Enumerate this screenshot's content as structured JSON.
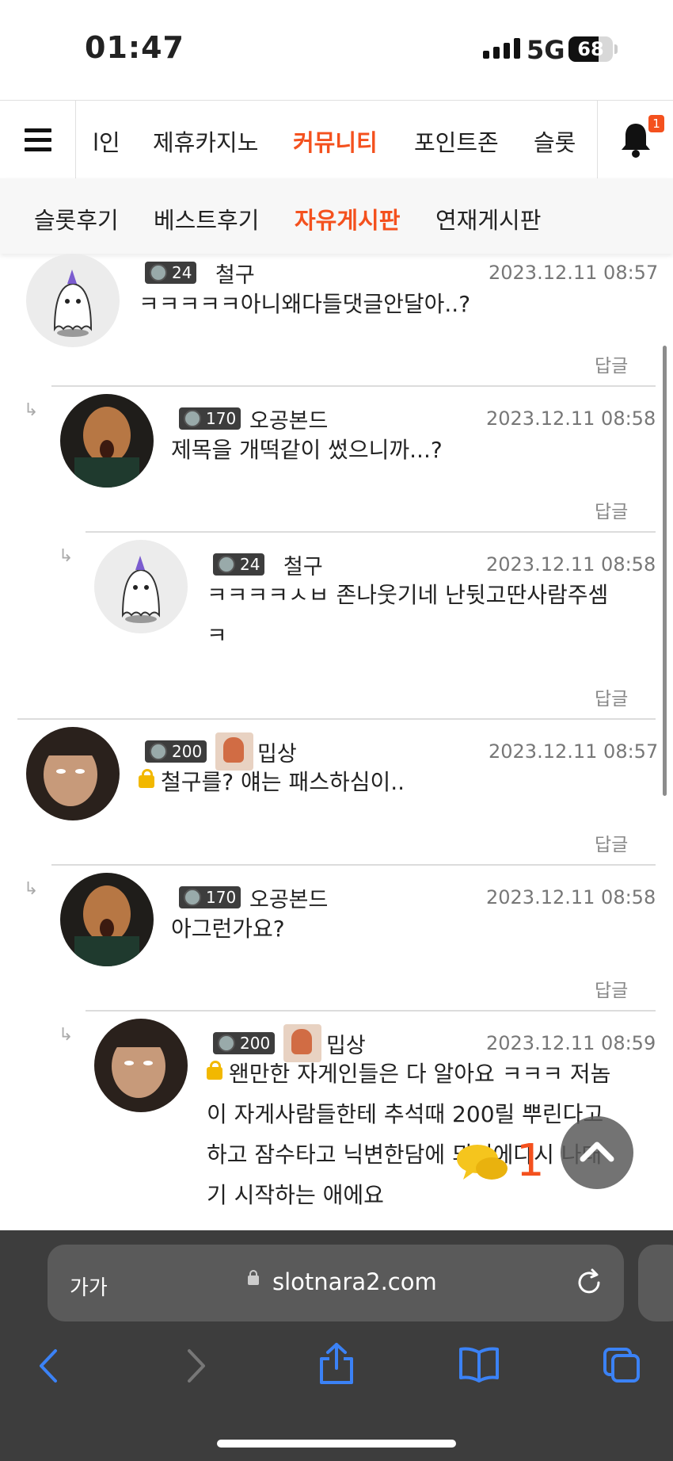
{
  "status_bar": {
    "time": "01:47",
    "network": "5G",
    "battery": "68",
    "battery_level": 0.68
  },
  "nav": {
    "tabs": [
      "l인",
      "제휴카지노",
      "커뮤니티",
      "포인트존",
      "슬롯"
    ],
    "notification_count": "1"
  },
  "subnav": {
    "tabs": [
      "슬롯후기",
      "베스트후기",
      "자유게시판",
      "연재게시판"
    ]
  },
  "comments": [
    {
      "level": "24",
      "name": "철구",
      "date": "2023.12.11 08:57",
      "lines": [
        "ㅋㅋㅋㅋㅋ아니왜다들댓글안달아..?"
      ],
      "reply": "답글"
    },
    {
      "level": "170",
      "name": "오공본드",
      "date": "2023.12.11 08:58",
      "lines": [
        "제목을 개떡같이 썼으니까...?"
      ],
      "reply": "답글"
    },
    {
      "level": "24",
      "name": "철구",
      "date": "2023.12.11 08:58",
      "lines": [
        "ㅋㅋㅋㅋㅅㅂ 존나웃기네 난뒷고딴사람주셈",
        "ㅋ"
      ],
      "reply": "답글"
    },
    {
      "level": "200",
      "name": "밉상",
      "date": "2023.12.11 08:57",
      "lines": [
        "철구를? 얘는 패스하심이.."
      ],
      "reply": "답글"
    },
    {
      "level": "170",
      "name": "오공본드",
      "date": "2023.12.11 08:58",
      "lines": [
        "아그런가요?"
      ],
      "reply": "답글"
    },
    {
      "level": "200",
      "name": "밉상",
      "date": "2023.12.11 08:59",
      "lines": [
        "왠만한 자게인들은 다 알아요 ㅋㅋㅋ 저놈",
        "이 자게사람들한테 추석때 200릴 뿌린다고",
        "하고 잠수타고 닉변한담에 뫼인에다시 나대",
        "기 시작하는 애에요"
      ]
    }
  ],
  "chat_badge": "1",
  "browser": {
    "aa_label": "가가",
    "url": "slotnara2.com"
  }
}
